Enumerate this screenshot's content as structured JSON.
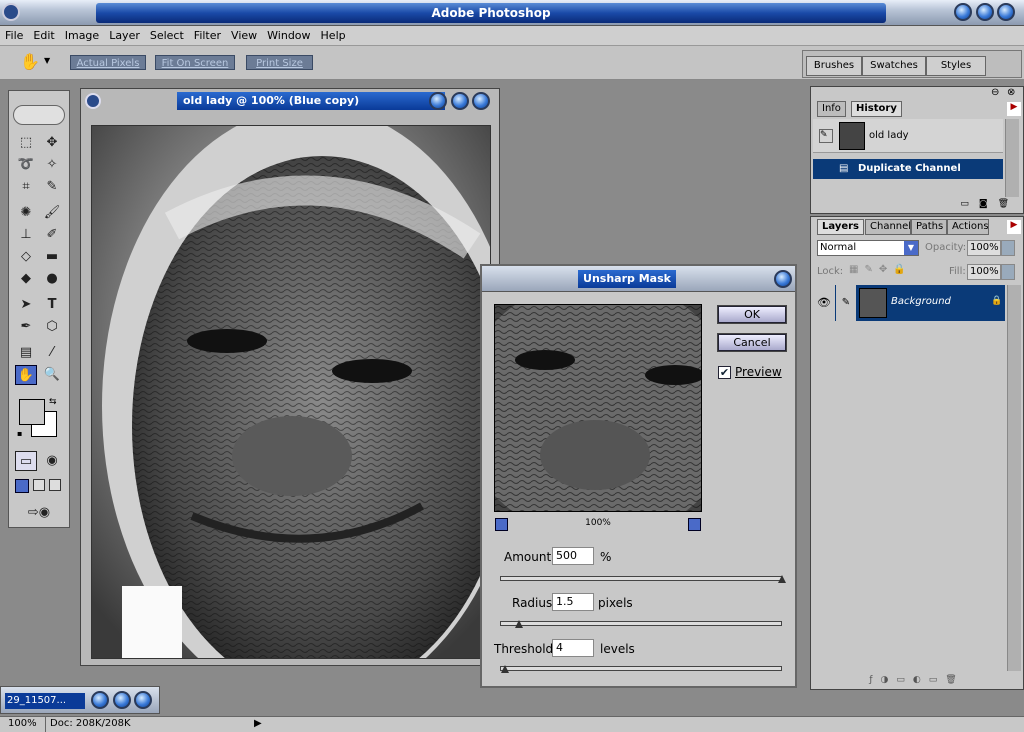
{
  "app": {
    "title": "Adobe Photoshop"
  },
  "menu": [
    "File",
    "Edit",
    "Image",
    "Layer",
    "Select",
    "Filter",
    "View",
    "Window",
    "Help"
  ],
  "options": {
    "actual_pixels": "Actual Pixels",
    "fit_on_screen": "Fit On Screen",
    "print_size": "Print Size"
  },
  "palette_well": {
    "tabs": [
      "Brushes",
      "Swatches",
      "Styles"
    ]
  },
  "document": {
    "title": "old lady @ 100% (Blue copy)"
  },
  "dialog": {
    "title": "Unsharp Mask",
    "ok": "OK",
    "cancel": "Cancel",
    "preview_label": "Preview",
    "preview_checked": true,
    "zoom": "100%",
    "amount": {
      "label": "Amount:",
      "value": "500",
      "unit": "%",
      "level": 1.0
    },
    "radius": {
      "label": "Radius:",
      "value": "1.5",
      "unit": "pixels",
      "level": 0.01
    },
    "threshold": {
      "label": "Threshold:",
      "value": "4",
      "unit": "levels",
      "level": 0.016
    }
  },
  "history": {
    "tabs": [
      "Info",
      "History"
    ],
    "snapshot": "old lady",
    "step": "Duplicate Channel"
  },
  "layers": {
    "tabs": [
      "Layers",
      "Channels",
      "Paths",
      "Actions"
    ],
    "blend_mode": "Normal",
    "opacity_label": "Opacity:",
    "opacity": "100%",
    "lock_label": "Lock:",
    "fill_label": "Fill:",
    "fill": "100%",
    "layer_name": "Background"
  },
  "minimized": {
    "title": "29_11507..."
  },
  "status": {
    "zoom": "100%",
    "doc": "Doc: 208K/208K"
  }
}
